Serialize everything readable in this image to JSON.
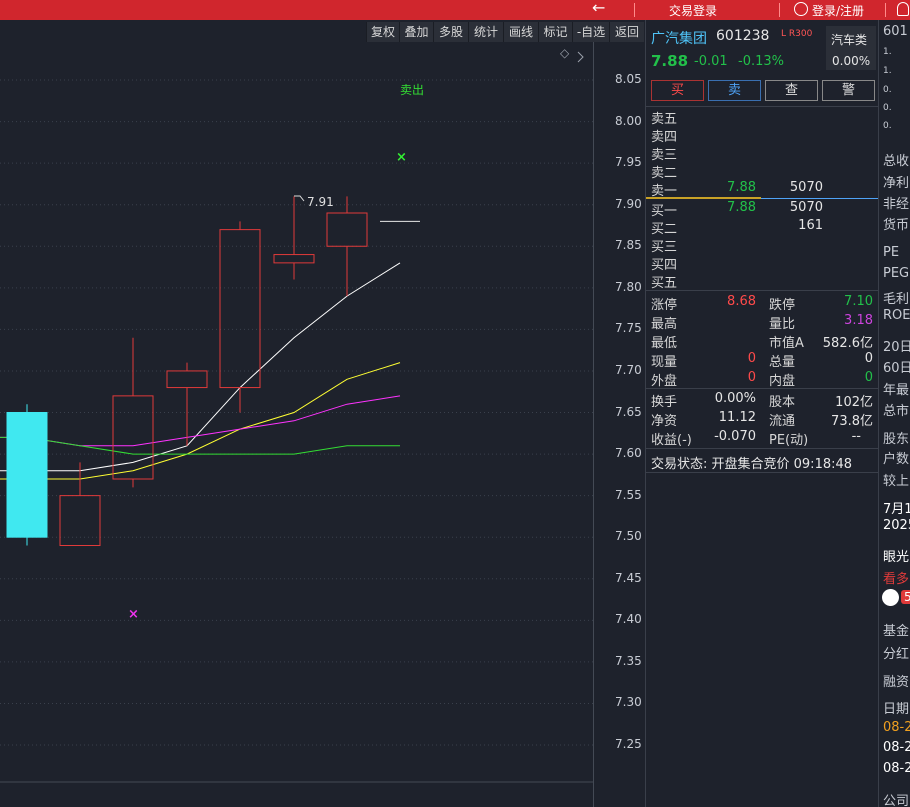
{
  "topbar": {
    "back_icon": "arrow-left-icon",
    "trade_login": "交易登录",
    "login_register": "登录/注册",
    "accent": "#d0262d"
  },
  "toolbar": {
    "items": [
      "复权",
      "叠加",
      "多股",
      "统计",
      "画线",
      "标记",
      "-自选",
      "返回"
    ]
  },
  "chart": {
    "sell_label": "卖出",
    "high_annotation": "7.91",
    "price_ticks": [
      "8.05",
      "8.00",
      "7.95",
      "7.90",
      "7.85",
      "7.80",
      "7.75",
      "7.70",
      "7.65",
      "7.60",
      "7.55",
      "7.50",
      "7.45",
      "7.40",
      "7.35",
      "7.30",
      "7.25"
    ],
    "colors": {
      "up": "#e03a3a",
      "down": "#40e8f0",
      "ma5": "#ffffff",
      "ma10": "#ffff33",
      "ma20": "#ff33ff",
      "ma60": "#33dd33"
    }
  },
  "chart_data": {
    "type": "candlestick",
    "ylim": [
      7.2,
      8.1
    ],
    "candles": [
      {
        "open": 7.65,
        "close": 7.5,
        "high": 7.66,
        "low": 7.49
      },
      {
        "open": 7.49,
        "close": 7.55,
        "high": 7.59,
        "low": 7.49
      },
      {
        "open": 7.57,
        "close": 7.67,
        "high": 7.74,
        "low": 7.56
      },
      {
        "open": 7.68,
        "close": 7.7,
        "high": 7.71,
        "low": 7.61
      },
      {
        "open": 7.68,
        "close": 7.87,
        "high": 7.88,
        "low": 7.65
      },
      {
        "open": 7.83,
        "close": 7.84,
        "high": 7.91,
        "low": 7.81
      },
      {
        "open": 7.85,
        "close": 7.89,
        "high": 7.91,
        "low": 7.79
      },
      {
        "open": 7.88,
        "close": 7.88,
        "high": 7.88,
        "low": 7.88
      }
    ],
    "series": [
      {
        "values": [
          7.58,
          7.58,
          7.59,
          7.61,
          7.68,
          7.74,
          7.79,
          7.83
        ]
      },
      {
        "values": [
          7.57,
          7.57,
          7.58,
          7.6,
          7.63,
          7.65,
          7.69,
          7.71
        ]
      },
      {
        "values": [
          7.62,
          7.61,
          7.61,
          7.62,
          7.63,
          7.64,
          7.66,
          7.67
        ]
      },
      {
        "values": [
          7.62,
          7.61,
          7.6,
          7.6,
          7.6,
          7.6,
          7.61,
          7.61
        ]
      }
    ]
  },
  "quote": {
    "name": "广汽集团",
    "code": "601238",
    "tags": "L R300",
    "sector": "汽车类",
    "sector_change": "0.00%",
    "last": "7.88",
    "change": "-0.01",
    "change_pct": "-0.13%",
    "actions": [
      "买",
      "卖",
      "查",
      "警"
    ],
    "ask_labels": [
      "卖五",
      "卖四",
      "卖三",
      "卖二",
      "卖一"
    ],
    "ask1_price": "7.88",
    "ask1_vol": "5070",
    "bid_labels": [
      "买一",
      "买二",
      "买三",
      "买四",
      "买五"
    ],
    "bid1_price": "7.88",
    "bid1_vol": "5070",
    "bid2_vol": "161",
    "stats": {
      "limit_up_label": "涨停",
      "limit_up": "8.68",
      "limit_down_label": "跌停",
      "limit_down": "7.10",
      "high_label": "最高",
      "vol_ratio_label": "量比",
      "vol_ratio": "3.18",
      "low_label": "最低",
      "mcap_label": "市值A",
      "mcap": "582.6亿",
      "cur_vol_label": "现量",
      "cur_vol": "0",
      "total_vol_label": "总量",
      "total_vol": "0",
      "outer_label": "外盘",
      "outer": "0",
      "inner_label": "内盘",
      "inner": "0",
      "turnover_label": "换手",
      "turnover": "0.00%",
      "shares_label": "股本",
      "shares": "102亿",
      "nav_label": "净资",
      "nav": "11.12",
      "float_label": "流通",
      "float": "73.8亿",
      "eps_label": "收益(-)",
      "eps": "-0.070",
      "pe_label": "PE(动)",
      "pe": "--"
    },
    "trade_status": "交易状态: 开盘集合竞价 09:18:48"
  },
  "side": {
    "items": [
      "601",
      "1.",
      "1.",
      "0.",
      "0.",
      "0.",
      "总收",
      "净利",
      "非经",
      "货币",
      "PE",
      "PEG",
      "毛利",
      "ROE",
      "20日",
      "60日",
      "年最",
      "总市",
      "股东",
      "户数",
      "较上",
      "7月1",
      "2025",
      "眼光",
      "看多",
      "5",
      "基金",
      "分红",
      "融资",
      "日期",
      "08-2",
      "08-2",
      "08-2",
      "公司"
    ]
  }
}
